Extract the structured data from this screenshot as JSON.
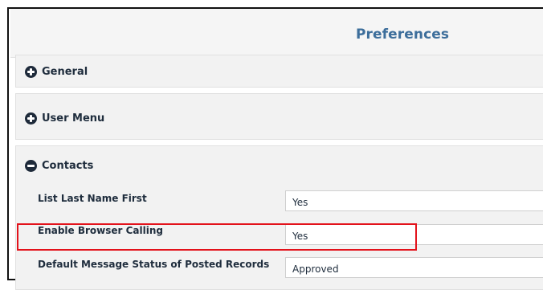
{
  "page": {
    "title": "Preferences"
  },
  "sections": [
    {
      "label": "General",
      "state": "collapsed",
      "icon": "plus-circle-icon"
    },
    {
      "label": "User Menu",
      "state": "collapsed",
      "icon": "plus-circle-icon"
    },
    {
      "label": "Contacts",
      "state": "expanded",
      "icon": "minus-circle-icon"
    }
  ],
  "contacts": {
    "rows": [
      {
        "label": "List Last Name First",
        "value": "Yes"
      },
      {
        "label": "Enable Browser Calling",
        "value": "Yes"
      },
      {
        "label": "Default Message Status of Posted Records",
        "value": "Approved"
      }
    ]
  },
  "colors": {
    "title": "#3d6e9b",
    "highlight_border": "#e3121b",
    "section_bg": "#f2f2f2"
  }
}
